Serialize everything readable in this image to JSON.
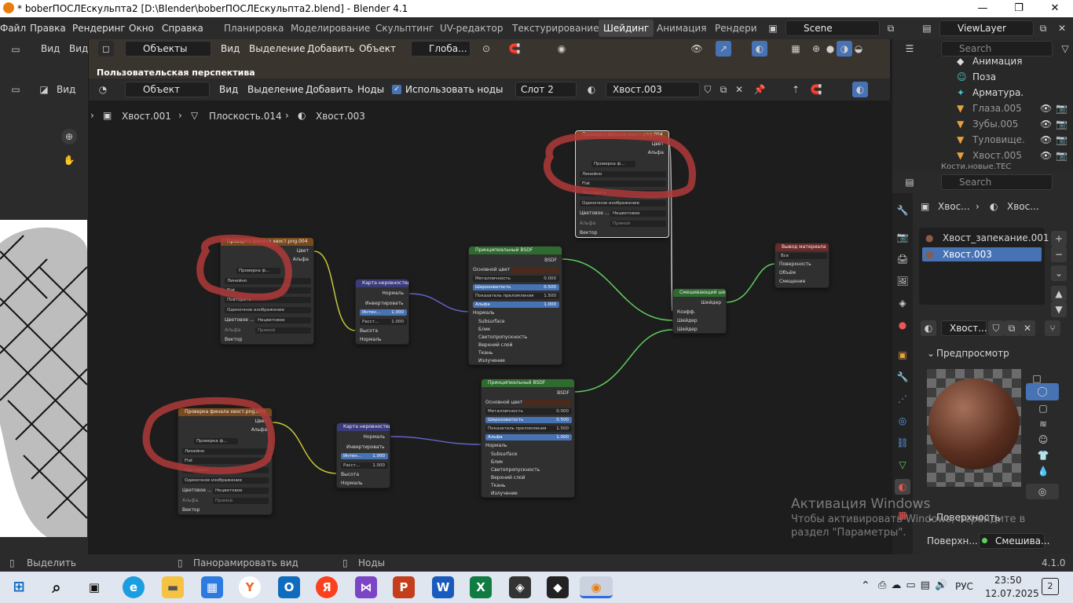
{
  "window": {
    "title": "* boberПОСЛЕскульпта2 [D:\\Blender\\boberПОСЛЕскульпта2.blend] - Blender 4.1",
    "minimize": "—",
    "maximize": "❐",
    "close": "✕"
  },
  "menu": {
    "items": [
      "Файл",
      "Правка",
      "Рендеринг",
      "Окно",
      "Справка"
    ]
  },
  "workspaces": {
    "tabs": [
      "Планировка",
      "Моделирование",
      "Скульптинг",
      "UV-редактор",
      "Текстурирование",
      "Шейдинг",
      "Анимация",
      "Рендери"
    ],
    "active": "Шейдинг"
  },
  "scene": {
    "label": "Scene"
  },
  "view_layer": {
    "label": "ViewLayer"
  },
  "viewport_header": {
    "view": "Вид",
    "mode": "Объекты",
    "view2": "Вид",
    "select": "Выделение",
    "add": "Добавить",
    "object": "Объект",
    "transform": "Глоба...",
    "perspective_label": "Пользовательская перспектива"
  },
  "image_editor": {
    "view": "Вид",
    "view2": "Вид"
  },
  "node_header": {
    "object_mode": "Объект",
    "view": "Вид",
    "select": "Выделение",
    "add": "Добавить",
    "nodes": "Ноды",
    "use_nodes": "Использовать ноды",
    "slot": "Слот 2",
    "material": "Хвост.003"
  },
  "breadcrumb": {
    "item1": "Хвост.001",
    "item2": "Плоскость.014",
    "item3": "Хвост.003"
  },
  "nodes": {
    "image_tex_label": "Проверка финала хвост.png.004",
    "image_tex_label2": "Проверка финала хвост.png.004",
    "image_tex_label3": "Проверка финала хвост.png.004",
    "img_field": "Проверка ф...",
    "img_count": "3",
    "out_color": "Цвет",
    "out_alpha": "Альфа",
    "interp": "Линейно",
    "proj": "Flat",
    "ext": "Повторить",
    "source": "Одиночное изображение",
    "colorspace_label": "Цветовое ...",
    "colorspace": "Нецветовое",
    "alpha_label": "Альфа",
    "alpha_val": "Прямой",
    "vector": "Вектор",
    "bump_title": "Карта неровностей",
    "bump_normal_out": "Нормаль",
    "bump_invert": "Инвертировать",
    "bump_strength": "Интен...",
    "bump_strength_val": "1.000",
    "bump_distance": "Расст...",
    "bump_distance_val": "1.000",
    "bump_height": "Высота",
    "bump_normal": "Нормаль",
    "bsdf_title": "Принципиальный BSDF",
    "bsdf_out": "BSDF",
    "base_color": "Основной цвет",
    "metallic": "Металличность",
    "metallic_val": "0.000",
    "roughness": "Шероховатость",
    "roughness_val": "0.500",
    "ior": "Показатель преломления",
    "ior_val": "1.500",
    "alpha": "Альфа",
    "alpha_v": "1.000",
    "normal": "Нормаль",
    "subsurface": "Subsurface",
    "specular": "Блик",
    "transmission": "Светопропускность",
    "coat": "Верхний слой",
    "sheen": "Ткань",
    "emission": "Излучение",
    "mix_title": "Смешивающий ше...",
    "mix_out": "Шейдер",
    "mix_fac": "Коэфф.",
    "mix_in1": "Шейдер",
    "mix_in2": "Шейдер",
    "out_title": "Вывод материала",
    "out_target": "Все",
    "out_surface": "Поверхность",
    "out_volume": "Объём",
    "out_displace": "Смещение"
  },
  "outliner": {
    "search": "Search",
    "rows": [
      "Анимация",
      "Поза",
      "Арматура.",
      "Глаза.005",
      "Зубы.005",
      "Туловище.",
      "Хвост.005",
      "Кости.новые.TEC"
    ]
  },
  "properties": {
    "search": "Search",
    "breadcrumb1": "Хвос...",
    "breadcrumb2": "Хвос...",
    "slots": [
      "Хвост_запекание.001",
      "Хвост.003"
    ],
    "material_field": "Хвост...",
    "preview_title": "Предпросмотр",
    "surface_title": "Поверхность",
    "surface_label": "Поверхн...",
    "surface_value": "Смешива..."
  },
  "statusbar": {
    "select": "Выделить",
    "pan": "Панорамировать вид",
    "nodes": "Ноды",
    "version": "4.1.0"
  },
  "watermark": {
    "line1": "Активация Windows",
    "line2": "Чтобы активировать Windows, перейдите в",
    "line3": "раздел \"Параметры\"."
  },
  "taskbar": {
    "lang": "РУС",
    "time": "23:50",
    "date": "12.07.2025",
    "notifications": "2"
  },
  "colors": {
    "accent": "#4772b3",
    "image_node_header": "#7a4a1e",
    "bsdf_header": "#2e6b2e",
    "vector_header": "#3b3b7a",
    "output_header": "#6b2a2a",
    "annotation": "#b03a3a"
  }
}
